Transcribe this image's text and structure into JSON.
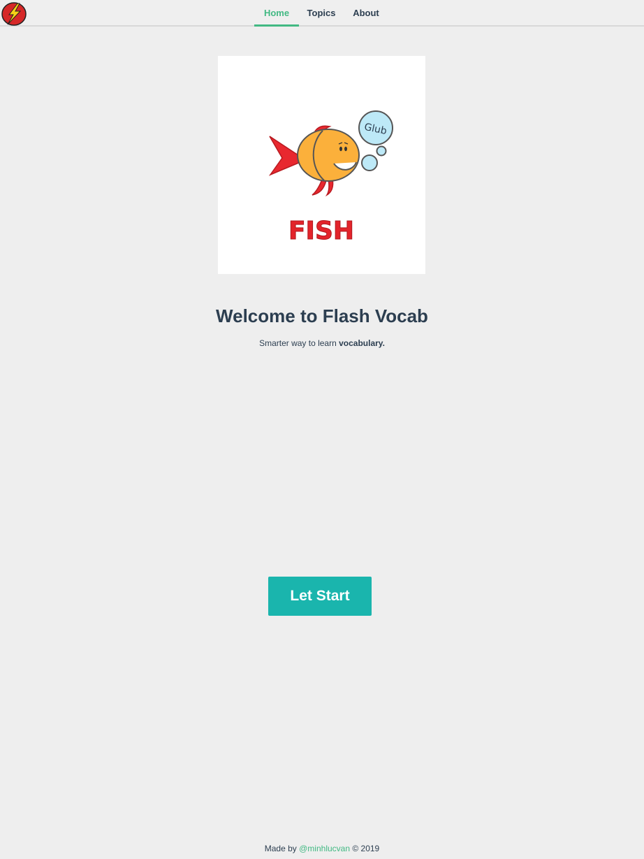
{
  "nav": {
    "logo_icon": "flash-lightning-icon",
    "items": [
      {
        "label": "Home",
        "active": true
      },
      {
        "label": "Topics",
        "active": false
      },
      {
        "label": "About",
        "active": false
      }
    ]
  },
  "hero": {
    "image_icon": "fish-illustration",
    "bubble_text": "Glub",
    "caption": "FISH"
  },
  "welcome": {
    "title": "Welcome to Flash Vocab",
    "subtitle_prefix": "Smarter way to learn ",
    "subtitle_bold": "vocabulary."
  },
  "cta": {
    "label": "Let Start"
  },
  "footer": {
    "prefix": "Made by ",
    "author": "@minhlucvan",
    "suffix": " © 2019"
  },
  "colors": {
    "accent": "#42b983",
    "button": "#1ab5ad",
    "text": "#2c3e50",
    "background": "#eeeeee"
  }
}
